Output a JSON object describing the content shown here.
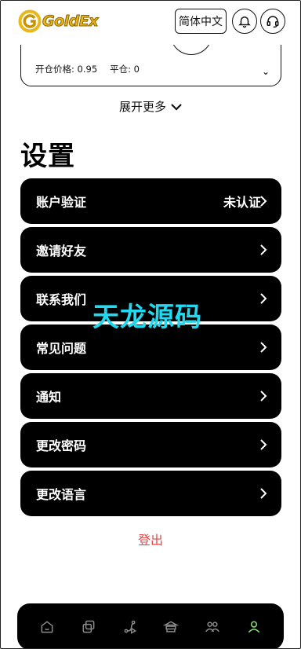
{
  "header": {
    "logo_text": "GoldEx",
    "language_label": "简体中文",
    "icons": {
      "bell": "bell-icon",
      "support": "headset-icon"
    }
  },
  "position_card": {
    "open_price": "开仓价格: 0.95",
    "close_label": "平仓: 0"
  },
  "expand_more": "展开更多",
  "section_title": "设置",
  "settings": [
    {
      "label": "账户验证",
      "status": "未认证"
    },
    {
      "label": "邀请好友",
      "status": ""
    },
    {
      "label": "联系我们",
      "status": ""
    },
    {
      "label": "常见问题",
      "status": ""
    },
    {
      "label": "通知",
      "status": ""
    },
    {
      "label": "更改密码",
      "status": ""
    },
    {
      "label": "更改语言",
      "status": ""
    }
  ],
  "watermark": "天龙源码",
  "logout_label": "登出",
  "bottom_nav": [
    {
      "icon": "home-icon"
    },
    {
      "icon": "copy-icon"
    },
    {
      "icon": "route-icon"
    },
    {
      "icon": "bank-icon"
    },
    {
      "icon": "users-icon"
    },
    {
      "icon": "profile-icon",
      "active": true
    }
  ],
  "colors": {
    "accent_green": "#7fd36b",
    "logout_red": "#e04a4a",
    "watermark_cyan": "#21d8ef",
    "logo_gold": "#e8b81a"
  }
}
